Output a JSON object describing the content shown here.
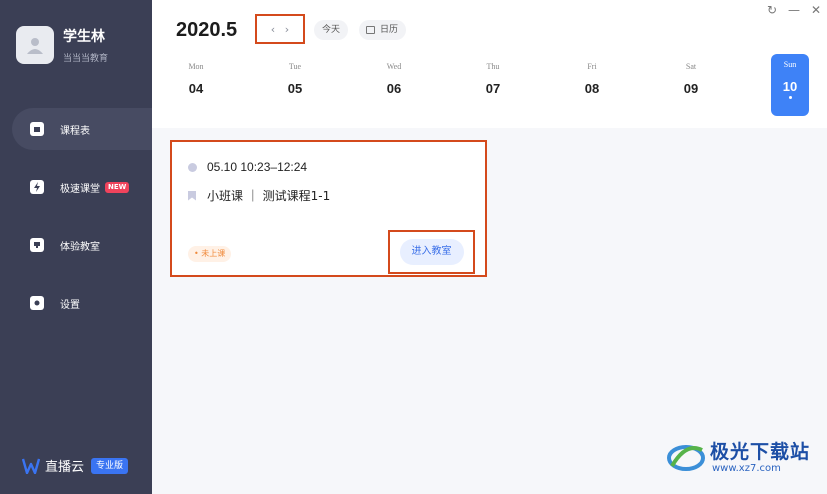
{
  "profile": {
    "name": "学生林",
    "org": "当当当教育"
  },
  "nav": [
    {
      "label": "课程表",
      "active": true
    },
    {
      "label": "极速课堂",
      "badge": "NEW"
    },
    {
      "label": "体验教室"
    },
    {
      "label": "设置"
    }
  ],
  "brand": {
    "name": "直播云",
    "badge": "专业版"
  },
  "header": {
    "year_month": "2020.5",
    "prev": "‹",
    "next": "›",
    "today": "今天",
    "calendar": "日历"
  },
  "week": [
    {
      "name": "Mon",
      "num": "04"
    },
    {
      "name": "Tue",
      "num": "05"
    },
    {
      "name": "Wed",
      "num": "06"
    },
    {
      "name": "Thu",
      "num": "07"
    },
    {
      "name": "Fri",
      "num": "08"
    },
    {
      "name": "Sat",
      "num": "09"
    },
    {
      "name": "Sun",
      "num": "10",
      "selected": true
    }
  ],
  "course": {
    "time": "05.10  10:23–12:24",
    "title": "小班课  ｜  测试课程1-1",
    "status": "• 未上课",
    "enter": "进入教室"
  },
  "window": {
    "refresh": "↻",
    "minimize": "—",
    "close": "✕"
  },
  "watermark": {
    "title": "极光下载站",
    "url": "www.xz7.com"
  },
  "colors": {
    "sidebar": "#3b3f55",
    "accent": "#3e82f7",
    "highlight": "#d44a1c"
  }
}
